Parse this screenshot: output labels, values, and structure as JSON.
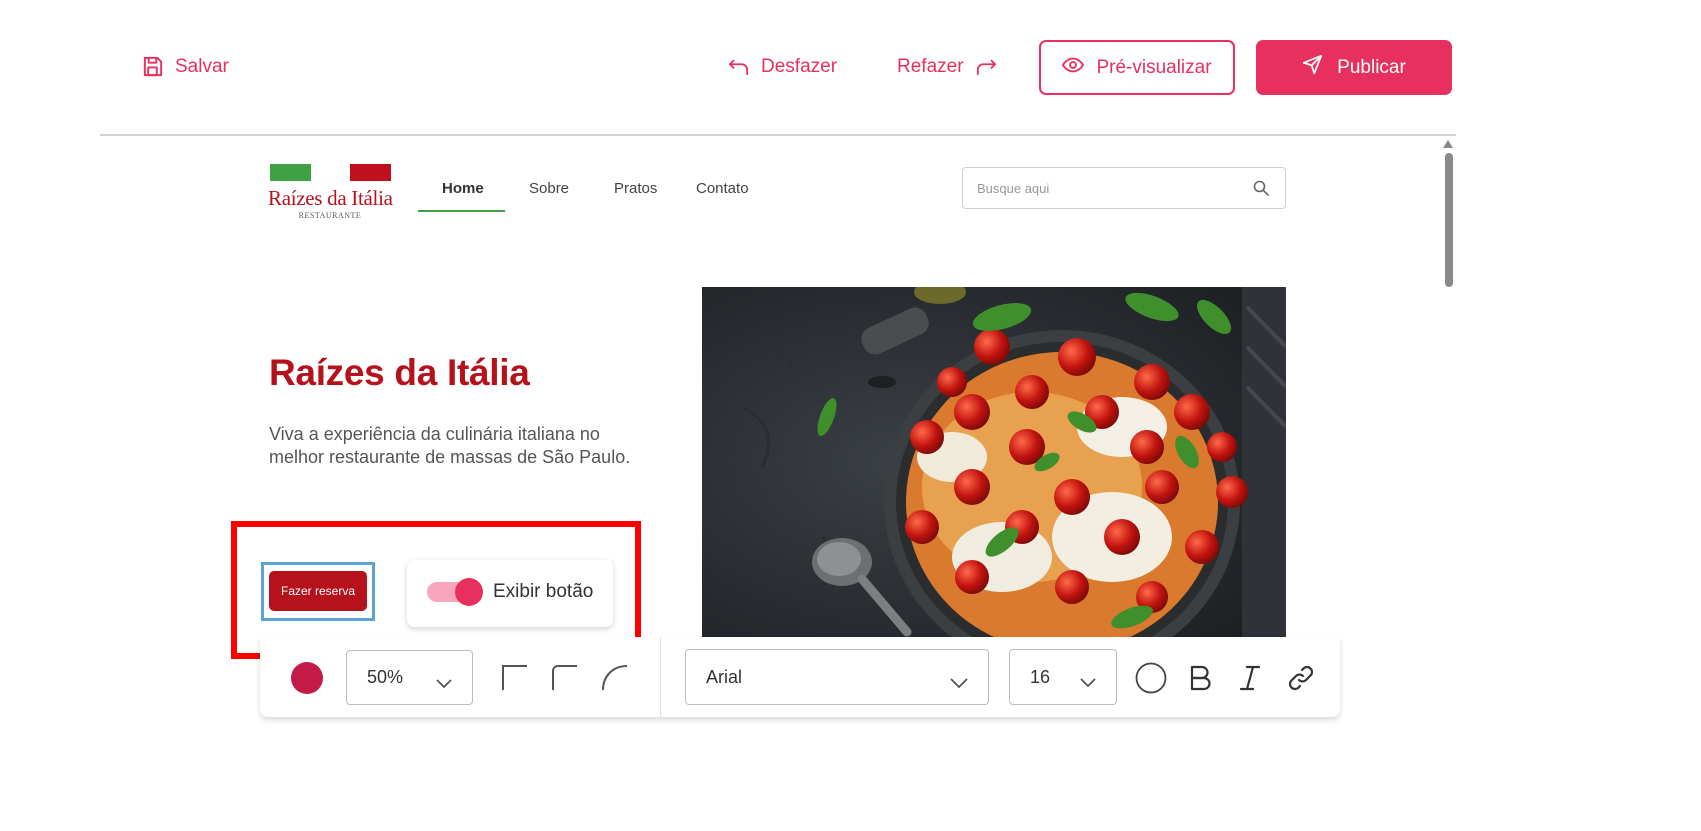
{
  "toolbar": {
    "save_label": "Salvar",
    "undo_label": "Desfazer",
    "redo_label": "Refazer",
    "preview_label": "Pré-visualizar",
    "publish_label": "Publicar",
    "accent_color": "#e8305f"
  },
  "site": {
    "logo_name": "Raízes da Itália",
    "logo_subtitle": "RESTAURANTE",
    "nav": [
      {
        "label": "Home",
        "active": true
      },
      {
        "label": "Sobre",
        "active": false
      },
      {
        "label": "Pratos",
        "active": false
      },
      {
        "label": "Contato",
        "active": false
      }
    ],
    "search_placeholder": "Busque aqui",
    "brand_color": "#b5121b"
  },
  "hero": {
    "title": "Raízes da Itália",
    "subtitle": "Viva a experiência da culinária italiana no melhor restaurante de massas de São Paulo.",
    "cta_label": "Fazer reserva",
    "image_alt": "Massa com tomates, mozzarella e manjericão em panela de ferro"
  },
  "toggle": {
    "label": "Exibir botão",
    "on": true
  },
  "format_bar": {
    "color": "#c41a48",
    "opacity": "50%",
    "font_family": "Arial",
    "font_size": "16",
    "icons": [
      "square-corner-icon",
      "rounded-corner-icon",
      "round-corner-icon",
      "circle-shape-icon",
      "bold-icon",
      "italic-icon",
      "link-icon"
    ]
  }
}
